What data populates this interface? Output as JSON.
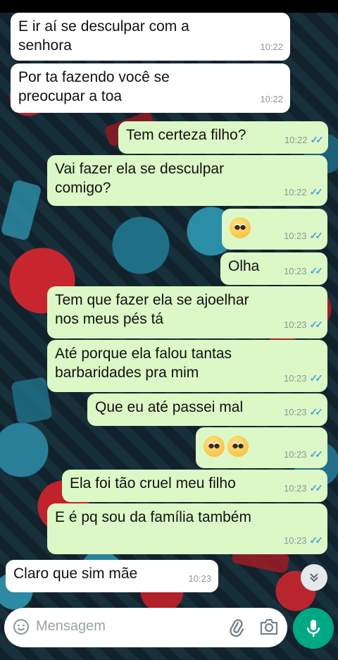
{
  "messages": [
    {
      "dir": "in",
      "text": "E ir aí se desculpar com a senhora",
      "time": "10:22"
    },
    {
      "dir": "in",
      "text": "Por ta fazendo você se preocupar a toa",
      "time": "10:22"
    },
    {
      "dir": "out",
      "text": "Tem certeza filho?",
      "time": "10:22"
    },
    {
      "dir": "out",
      "text": "Vai fazer ela se desculpar comigo?",
      "time": "10:22"
    },
    {
      "dir": "out",
      "text": "",
      "emoji_count": 1,
      "time": "10:23"
    },
    {
      "dir": "out",
      "text": "Olha",
      "time": "10:23"
    },
    {
      "dir": "out",
      "text": "Tem que fazer ela se ajoelhar nos meus pés tá",
      "time": "10:23"
    },
    {
      "dir": "out",
      "text": "Até porque ela falou tantas barbaridades pra mim",
      "time": "10:23"
    },
    {
      "dir": "out",
      "text": "Que eu até passei mal",
      "time": "10:23"
    },
    {
      "dir": "out",
      "text": "",
      "emoji_count": 2,
      "time": "10:23"
    },
    {
      "dir": "out",
      "text": "Ela foi tão cruel meu filho",
      "time": "10:23"
    },
    {
      "dir": "out",
      "text": "E é pq sou da família também",
      "time": "10:23"
    },
    {
      "dir": "in",
      "text": "Claro que sim mãe",
      "time": "10:23"
    }
  ],
  "composer": {
    "placeholder": "Mensagem"
  },
  "icons": {
    "emoji": "smiley-icon",
    "attach": "paperclip-icon",
    "camera": "camera-icon",
    "mic": "microphone-icon",
    "scroll": "double-chevron-down-icon",
    "read": "double-check-icon"
  },
  "colors": {
    "outgoing": "#dcf8c6",
    "incoming": "#ffffff",
    "accent": "#00a884",
    "read_tick": "#4fa3e0"
  }
}
